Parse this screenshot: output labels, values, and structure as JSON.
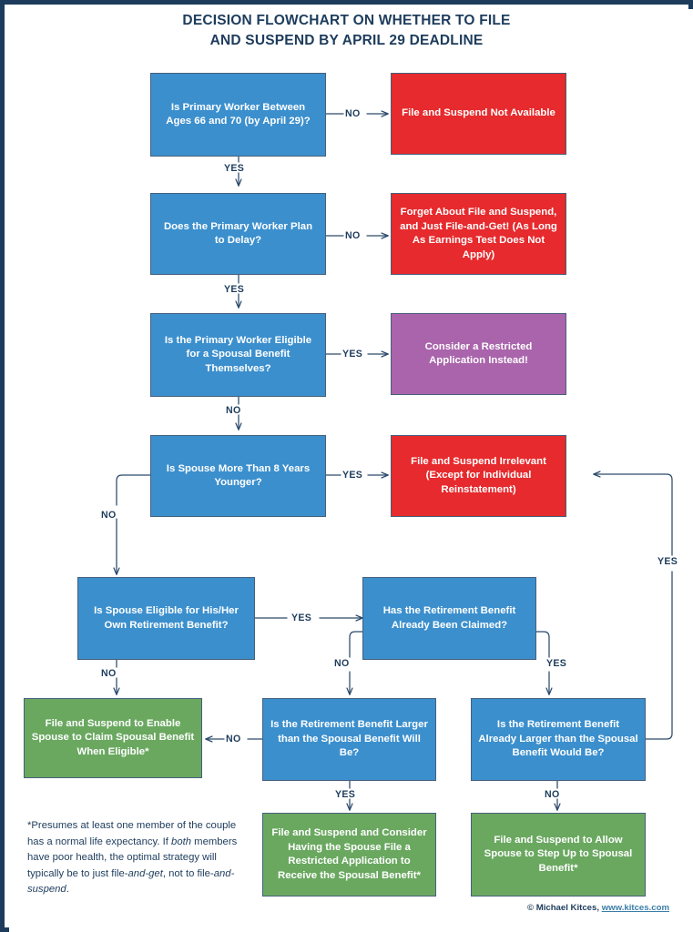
{
  "title": {
    "line1": "DECISION FLOWCHART ON WHETHER TO FILE",
    "line2": "AND SUSPEND BY APRIL 29 DEADLINE"
  },
  "colors": {
    "frame": "#1d3c5c",
    "question": "#3b8fcd",
    "negative": "#e62a2d",
    "alternate": "#a964ab",
    "positive": "#6aa860",
    "text_dark": "#1d3c5c",
    "link": "#3b7ea8"
  },
  "nodes": {
    "q1": "Is Primary Worker Between Ages 66 and 70 (by April 29)?",
    "r1": "File and Suspend Not Available",
    "q2": "Does the Primary Worker Plan to Delay?",
    "r2": "Forget About File and Suspend, and Just File-and-Get! (As Long As Earnings Test Does Not Apply)",
    "q3": "Is the Primary Worker Eligible for a Spousal Benefit Themselves?",
    "r3": "Consider a Restricted Application Instead!",
    "q4": "Is Spouse More Than 8 Years Younger?",
    "r4": "File and Suspend Irrelevant (Except for Individual Reinstatement)",
    "q5": "Is Spouse Eligible for His/Her Own Retirement Benefit?",
    "q6": "Has the Retirement Benefit Already Been Claimed?",
    "g1": "File and Suspend to Enable Spouse to Claim Spousal Benefit When Eligible*",
    "q7": "Is the Retirement Benefit Larger than the Spousal Benefit Will Be?",
    "q8": "Is the Retirement Benefit Already Larger than the Spousal Benefit Would Be?",
    "g2": "File and Suspend and Consider Having the Spouse File a Restricted Application to Receive the Spousal Benefit*",
    "g3": "File and Suspend to Allow Spouse to Step Up to Spousal Benefit*"
  },
  "edges": {
    "q1_no": "NO",
    "q1_yes": "YES",
    "q2_no": "NO",
    "q2_yes": "YES",
    "q3_yes": "YES",
    "q3_no": "NO",
    "q4_yes": "YES",
    "q4_no": "NO",
    "q5_yes": "YES",
    "q5_no": "NO",
    "q6_no": "NO",
    "q6_yes": "YES",
    "q7_no": "NO",
    "q7_yes": "YES",
    "q8_no": "NO",
    "q8_yes": "YES"
  },
  "footnote": {
    "part1": "*Presumes at least one member of the couple has a normal life expectancy. If ",
    "em1": "both",
    "part2": " members have poor health, the optimal strategy will typically be to just file-",
    "em2": "and-get",
    "part3": ", not to file-",
    "em3": "and-suspend",
    "part4": "."
  },
  "attribution": {
    "copyright": "© Michael Kitces,",
    "url": "www.kitces.com"
  }
}
